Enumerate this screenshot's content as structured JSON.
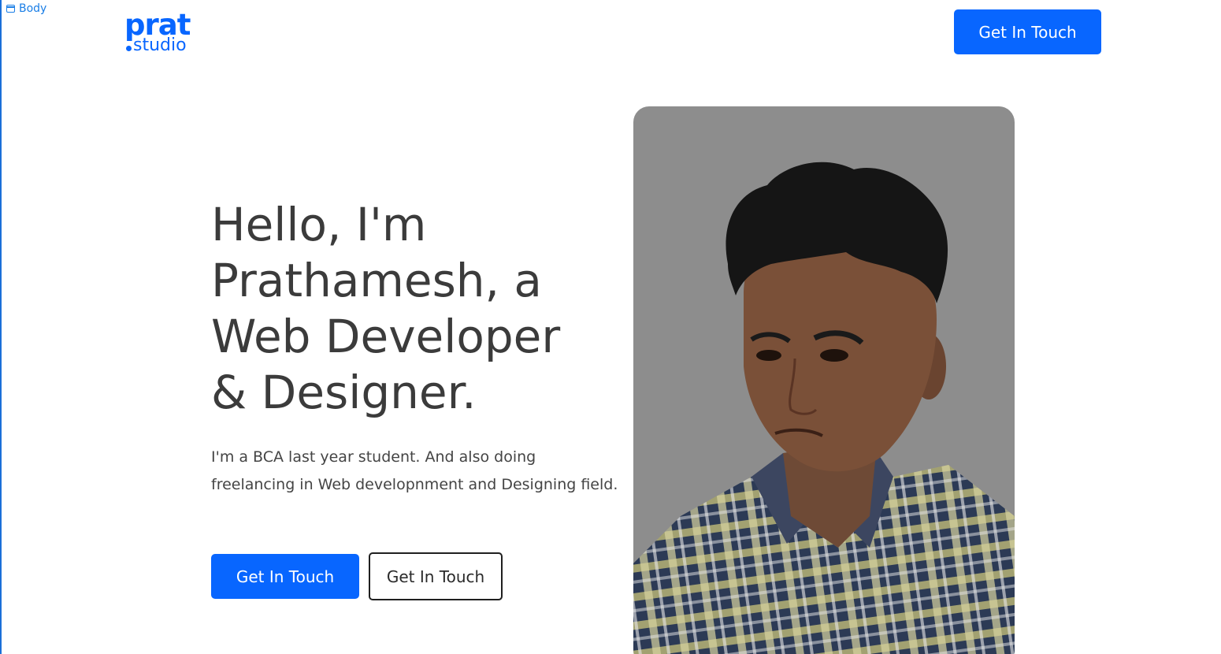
{
  "editor": {
    "tag_label": "Body"
  },
  "header": {
    "logo": {
      "top": "prat",
      "bottom": "studio"
    },
    "cta_label": "Get In Touch"
  },
  "hero": {
    "heading_lines": [
      "Hello, I'm",
      "Prathamesh, a",
      "Web Developer",
      "& Designer."
    ],
    "subtext": "I'm a BCA last year student. And also doing freelancing in Web developnment and Designing field.",
    "primary_button_label": "Get In Touch",
    "secondary_button_label": "Get In Touch"
  },
  "colors": {
    "accent": "#0866ff",
    "text": "#3b3b3b",
    "portrait_bg": "#8d8d8d"
  }
}
